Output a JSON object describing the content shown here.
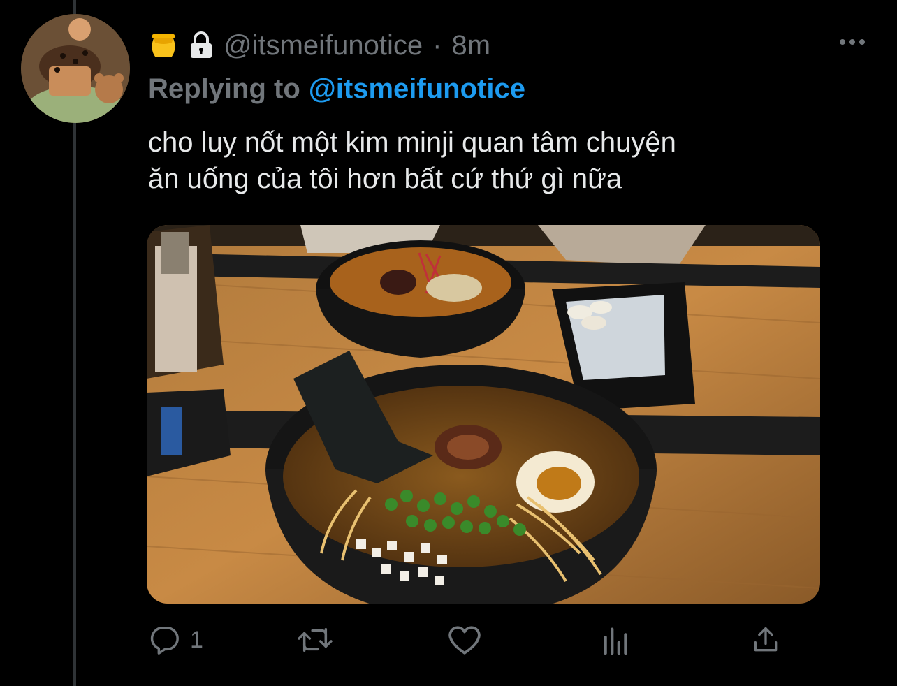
{
  "tweet": {
    "handle": "@itsmeifunotice",
    "separator": "·",
    "time": "8m",
    "replying_prefix": "Replying to",
    "replying_mention": "@itsmeifunotice",
    "text_lines": [
      "cho luỵ nốt một kim minji quan tâm chuyện",
      "ăn uống của tôi hơn bất cứ thứ gì nữa"
    ]
  },
  "actions": {
    "reply_count": "1",
    "retweet_count": "",
    "like_count": ""
  },
  "icons": {
    "badge": "honey-pot-icon",
    "lock": "lock-icon",
    "more": "more-icon",
    "reply": "reply-icon",
    "retweet": "retweet-icon",
    "like": "heart-icon",
    "analytics": "analytics-icon",
    "share": "share-icon"
  },
  "colors": {
    "background": "#000000",
    "text": "#e7e9ea",
    "muted": "#71767b",
    "link": "#1d9bf0",
    "thread_line": "#2f3336"
  }
}
